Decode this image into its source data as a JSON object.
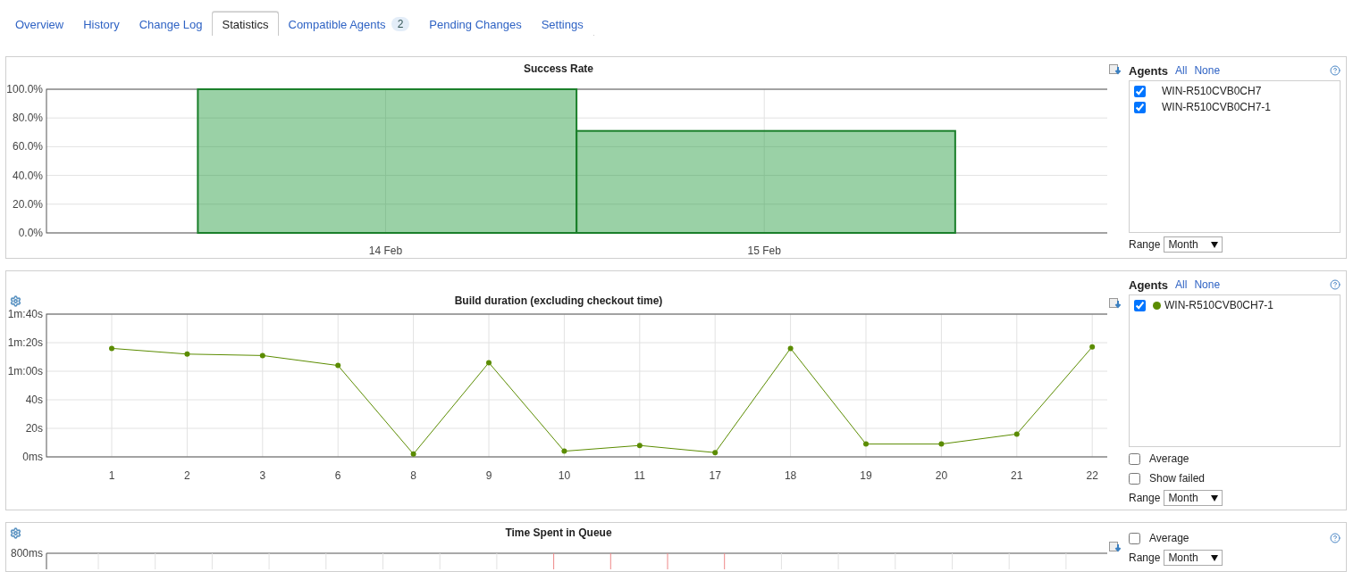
{
  "tabs": [
    {
      "label": "Overview",
      "selected": false
    },
    {
      "label": "History",
      "selected": false
    },
    {
      "label": "Change Log",
      "selected": false
    },
    {
      "label": "Statistics",
      "selected": true
    },
    {
      "label": "Compatible Agents",
      "badge": "2",
      "selected": false
    },
    {
      "label": "Pending Changes",
      "selected": false
    },
    {
      "label": "Settings",
      "selected": false
    }
  ],
  "panels": [
    {
      "kind": "success_rate",
      "has_settings": false,
      "chart_data": {
        "type": "bar",
        "title": "Success Rate",
        "grid": true,
        "categories": [
          "14 Feb",
          "15 Feb"
        ],
        "series": [
          {
            "color": "#1a7f2a",
            "values": [
              100,
              71
            ]
          }
        ],
        "ylim": [
          0,
          100
        ],
        "yticks": [
          {
            "value": 0,
            "label": "0.0%"
          },
          {
            "value": 20,
            "label": "20.0%"
          },
          {
            "value": 40,
            "label": "40.0%"
          },
          {
            "value": 60,
            "label": "60.0%"
          },
          {
            "value": 80,
            "label": "80.0%"
          },
          {
            "value": 100,
            "label": "100.0%"
          }
        ]
      },
      "sidebar": {
        "agents_label": "Agents",
        "all": "All",
        "none": "None",
        "agents": [
          {
            "name": "WIN-R510CVB0CH7",
            "checked": true
          },
          {
            "name": "WIN-R510CVB0CH7-1",
            "checked": true
          }
        ],
        "range_label": "Range",
        "range": "Month"
      }
    },
    {
      "kind": "duration",
      "has_settings": true,
      "chart_data": {
        "type": "line",
        "title": "Build duration (excluding checkout time)",
        "grid": true,
        "categories": [
          "1",
          "2",
          "3",
          "6",
          "8",
          "9",
          "10",
          "11",
          "17",
          "18",
          "19",
          "20",
          "21",
          "22"
        ],
        "series": [
          {
            "color": "#5b8c00",
            "marker": "circle",
            "values": [
              76,
              72,
              71,
              64,
              2,
              66,
              4,
              8,
              3,
              76,
              9,
              9,
              16,
              77
            ]
          }
        ],
        "ylim": [
          0,
          100
        ],
        "yticks": [
          {
            "value": 0,
            "label": "0ms"
          },
          {
            "value": 20,
            "label": "20s"
          },
          {
            "value": 40,
            "label": "40s"
          },
          {
            "value": 60,
            "label": "1m:00s"
          },
          {
            "value": 80,
            "label": "1m:20s"
          },
          {
            "value": 100,
            "label": "1m:40s"
          }
        ]
      },
      "sidebar": {
        "agents_label": "Agents",
        "all": "All",
        "none": "None",
        "agents": [
          {
            "name": "WIN-R510CVB0CH7-1",
            "checked": true,
            "color": "#5b8c00"
          }
        ],
        "options": [
          {
            "label": "Average",
            "checked": false
          },
          {
            "label": "Show failed",
            "checked": false
          }
        ],
        "range_label": "Range",
        "range": "Month"
      }
    },
    {
      "kind": "queue",
      "has_settings": true,
      "title": "Time Spent in Queue",
      "top_tick": "800ms",
      "sidebar": {
        "options": [
          {
            "label": "Average",
            "checked": false
          }
        ],
        "range_label": "Range",
        "range": "Month"
      }
    }
  ]
}
